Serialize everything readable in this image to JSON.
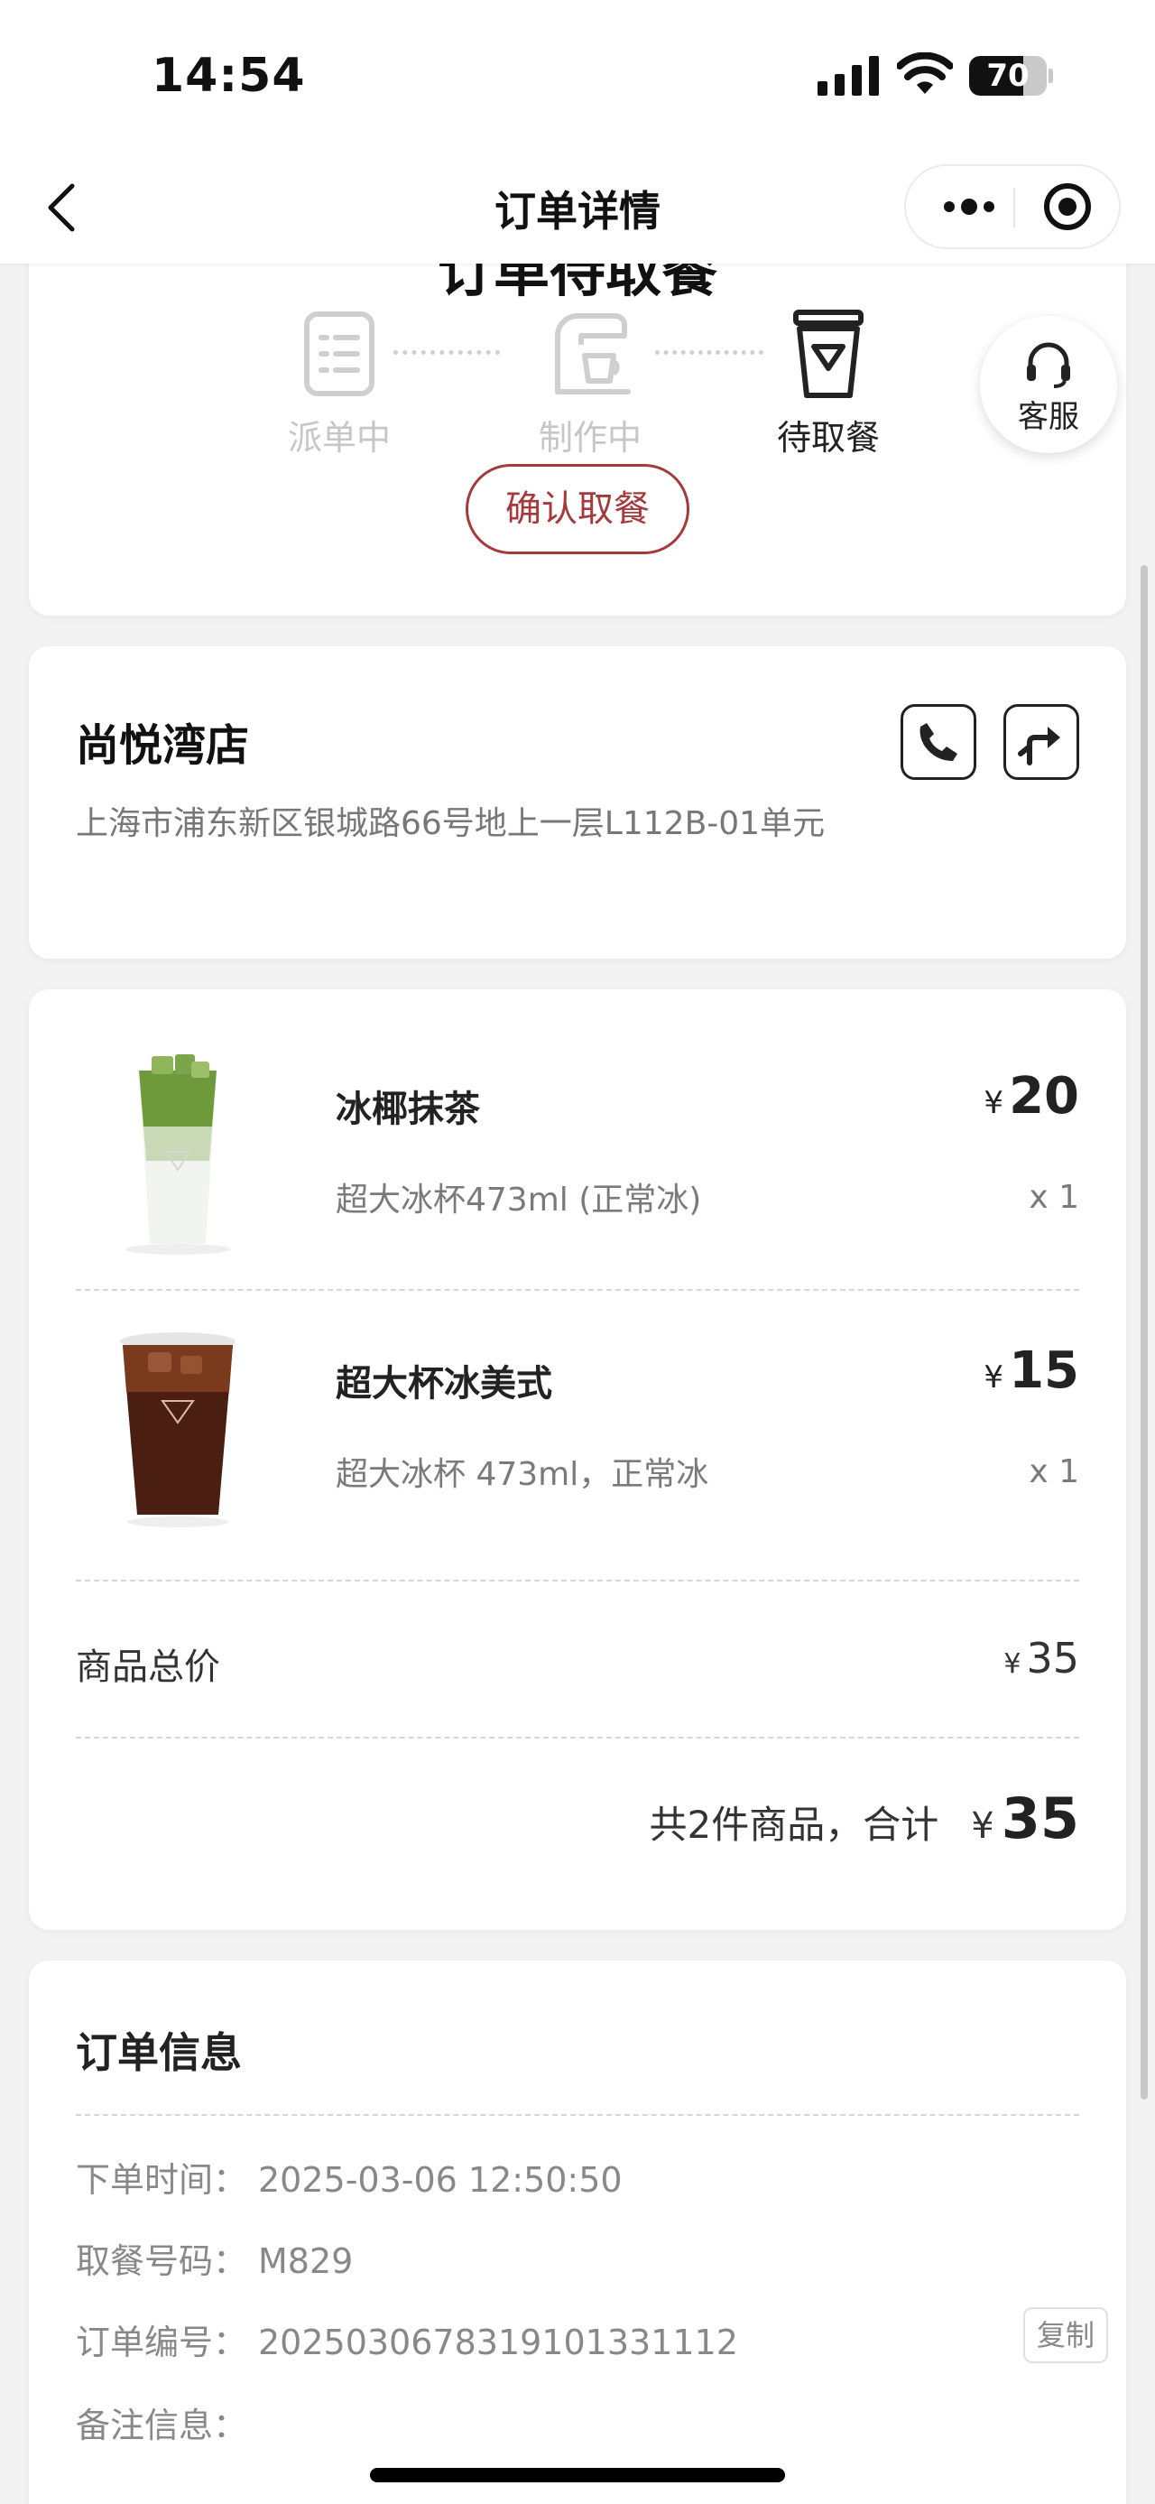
{
  "status_bar": {
    "time": "14:54",
    "battery": "70",
    "battery_level": 0.7
  },
  "nav": {
    "title": "订单详情",
    "back": "back",
    "more": "more",
    "close": "close"
  },
  "order_status": {
    "title": "订单待取餐",
    "steps": [
      {
        "label": "派单中",
        "icon": "dispatch-list-icon",
        "state": "done"
      },
      {
        "label": "制作中",
        "icon": "coffee-machine-icon",
        "state": "done"
      },
      {
        "label": "待取餐",
        "icon": "takeaway-cup-icon",
        "state": "active"
      }
    ],
    "confirm_button": "确认取餐"
  },
  "customer_service": {
    "label": "客服",
    "icon": "headset-icon"
  },
  "store": {
    "name": "尚悦湾店",
    "address": "上海市浦东新区银城路66号地上一层L112B-01单元",
    "call_icon": "phone-icon",
    "nav_icon": "directions-icon"
  },
  "items": [
    {
      "name": "冰椰抹茶",
      "spec": "超大冰杯473ml (正常冰)",
      "currency": "¥",
      "price": "20",
      "qty": "x 1"
    },
    {
      "name": "超大杯冰美式",
      "spec": "超大冰杯 473ml，正常冰",
      "currency": "¥",
      "price": "15",
      "qty": "x 1"
    }
  ],
  "summary": {
    "subtotal_label": "商品总价",
    "currency": "¥",
    "subtotal": "35",
    "total_text": "共2件商品，合计",
    "total": "35"
  },
  "order_info": {
    "title": "订单信息",
    "rows": [
      {
        "key": "下单时间：",
        "value": "2025-03-06 12:50:50"
      },
      {
        "key": "取餐号码：",
        "value": "M829"
      },
      {
        "key": "订单编号：",
        "value": "2025030678319101331112"
      },
      {
        "key": "备注信息：",
        "value": ""
      }
    ],
    "copy_button": "复制"
  },
  "colors": {
    "accent": "#a53a3d",
    "background": "#f3f3f3",
    "card": "#ffffff",
    "muted": "#c6c6c6"
  }
}
